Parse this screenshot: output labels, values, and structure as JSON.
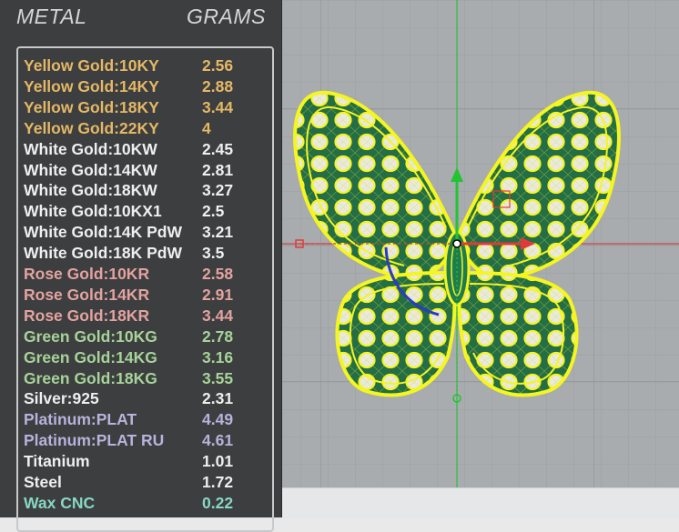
{
  "header": {
    "metal_label": "METAL",
    "grams_label": "GRAMS"
  },
  "colors": {
    "yellow": "#e4b866",
    "white": "#efefef",
    "rose": "#e3a3a0",
    "green": "#a7d49a",
    "silver": "#efefef",
    "platinum": "#b7b3dc",
    "titanium": "#efefef",
    "steel": "#efefef",
    "wax": "#87d8c4",
    "viewport_bg": "#a8acae",
    "model_yellow": "#f5f51f",
    "model_green": "#1e7d4f"
  },
  "metals": [
    {
      "name": "Yellow Gold:10KY",
      "grams": "2.56",
      "color": "#e4b866"
    },
    {
      "name": "Yellow Gold:14KY",
      "grams": "2.88",
      "color": "#e4b866"
    },
    {
      "name": "Yellow Gold:18KY",
      "grams": "3.44",
      "color": "#e4b866"
    },
    {
      "name": "Yellow Gold:22KY",
      "grams": "4",
      "color": "#e4b866"
    },
    {
      "name": "White Gold:10KW",
      "grams": "2.45",
      "color": "#efefef"
    },
    {
      "name": "White Gold:14KW",
      "grams": "2.81",
      "color": "#efefef"
    },
    {
      "name": "White Gold:18KW",
      "grams": "3.27",
      "color": "#efefef"
    },
    {
      "name": "White Gold:10KX1",
      "grams": "2.5",
      "color": "#efefef"
    },
    {
      "name": "White Gold:14K PdW",
      "grams": "3.21",
      "color": "#efefef"
    },
    {
      "name": "White Gold:18K PdW",
      "grams": "3.5",
      "color": "#efefef"
    },
    {
      "name": "Rose Gold:10KR",
      "grams": "2.58",
      "color": "#e3a3a0"
    },
    {
      "name": "Rose Gold:14KR",
      "grams": "2.91",
      "color": "#e3a3a0"
    },
    {
      "name": "Rose Gold:18KR",
      "grams": "3.44",
      "color": "#e3a3a0"
    },
    {
      "name": "Green Gold:10KG",
      "grams": "2.78",
      "color": "#a7d49a"
    },
    {
      "name": "Green Gold:14KG",
      "grams": "3.16",
      "color": "#a7d49a"
    },
    {
      "name": "Green Gold:18KG",
      "grams": "3.55",
      "color": "#a7d49a"
    },
    {
      "name": "Silver:925",
      "grams": "2.31",
      "color": "#efefef"
    },
    {
      "name": "Platinum:PLAT",
      "grams": "4.49",
      "color": "#b7b3dc"
    },
    {
      "name": "Platinum:PLAT RU",
      "grams": "4.61",
      "color": "#b7b3dc"
    },
    {
      "name": "Titanium",
      "grams": "1.01",
      "color": "#efefef"
    },
    {
      "name": "Steel",
      "grams": "1.72",
      "color": "#efefef"
    },
    {
      "name": "Wax  CNC",
      "grams": "0.22",
      "color": "#87d8c4"
    }
  ],
  "viewport": {
    "model_icon": "butterfly-model",
    "gizmo_icon": "transform-gizmo"
  }
}
